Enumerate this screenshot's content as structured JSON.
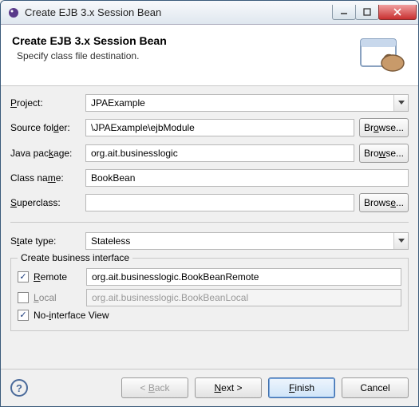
{
  "title": "Create EJB 3.x Session Bean",
  "banner": {
    "title": "Create EJB 3.x Session Bean",
    "subtitle": "Specify class file destination."
  },
  "labels": {
    "project": "Project:",
    "sourceFolder": "Source folder:",
    "javaPackage": "Java package:",
    "className": "Class name:",
    "superclass": "Superclass:",
    "stateType": "State type:",
    "groupTitle": "Create business interface",
    "remote": "Remote",
    "local": "Local",
    "noInterface": "No-interface View",
    "browse": "Browse..."
  },
  "values": {
    "project": "JPAExample",
    "sourceFolder": "\\JPAExample\\ejbModule",
    "javaPackage": "org.ait.businesslogic",
    "className": "BookBean",
    "superclass": "",
    "stateType": "Stateless",
    "remote": "org.ait.businesslogic.BookBeanRemote",
    "local": "org.ait.businesslogic.BookBeanLocal"
  },
  "buttons": {
    "back": "< Back",
    "next": "Next >",
    "finish": "Finish",
    "cancel": "Cancel"
  }
}
